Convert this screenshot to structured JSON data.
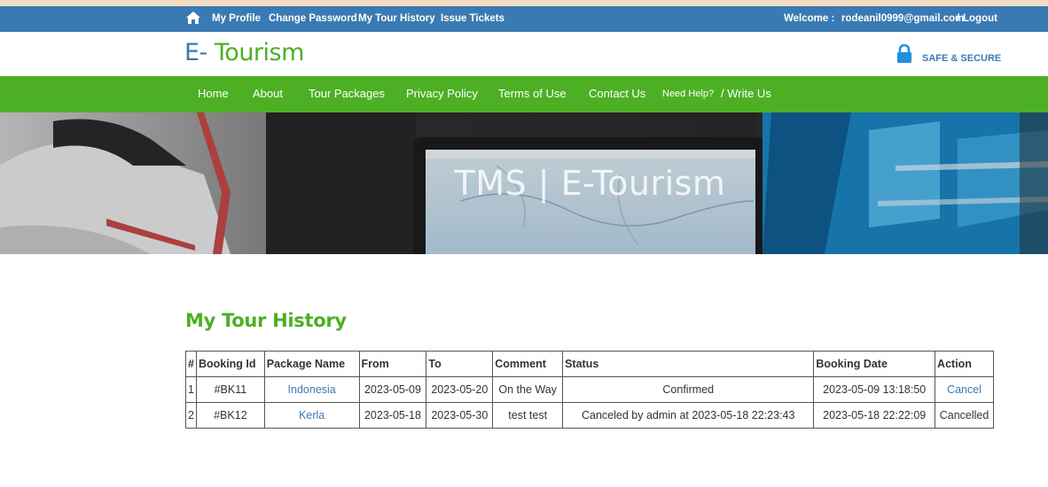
{
  "topbar": {
    "links": [
      "My Profile",
      "Change Password",
      "My Tour History",
      "Issue Tickets"
    ],
    "welcome_label": "Welcome :",
    "user_email": "rodeanil0999@gmail.com",
    "separator": "/",
    "logout_label": "Logout"
  },
  "header": {
    "logo_prefix": "E-",
    "logo_suffix": " Tourism",
    "safe_label": "SAFE & SECURE"
  },
  "nav": {
    "items": [
      "Home",
      "About",
      "Tour Packages",
      "Privacy Policy",
      "Terms of Use",
      "Contact Us"
    ],
    "help_label": "Need Help?",
    "write_label": "/ Write Us"
  },
  "banner": {
    "title": "TMS | E-Tourism"
  },
  "main": {
    "title": "My Tour History",
    "columns": [
      "#",
      "Booking Id",
      "Package Name",
      "From",
      "To",
      "Comment",
      "Status",
      "Booking Date",
      "Action"
    ],
    "rows": [
      {
        "num": "1",
        "booking_id": "#BK11",
        "package": "Indonesia",
        "from": "2023-05-09",
        "to": "2023-05-20",
        "comment": "On the Way",
        "status": "Confirmed",
        "booking_date": "2023-05-09 13:18:50",
        "action": "Cancel"
      },
      {
        "num": "2",
        "booking_id": "#BK12",
        "package": "Kerla",
        "from": "2023-05-18",
        "to": "2023-05-30",
        "comment": "test test",
        "status": "Canceled by admin at 2023-05-18 22:23:43",
        "booking_date": "2023-05-18 22:22:09",
        "action": "Cancelled"
      }
    ]
  },
  "colors": {
    "topbar_blue": "#3a7ab3",
    "nav_green": "#4db024",
    "title_green": "#4bb024",
    "link_blue": "#3a7ab3"
  }
}
